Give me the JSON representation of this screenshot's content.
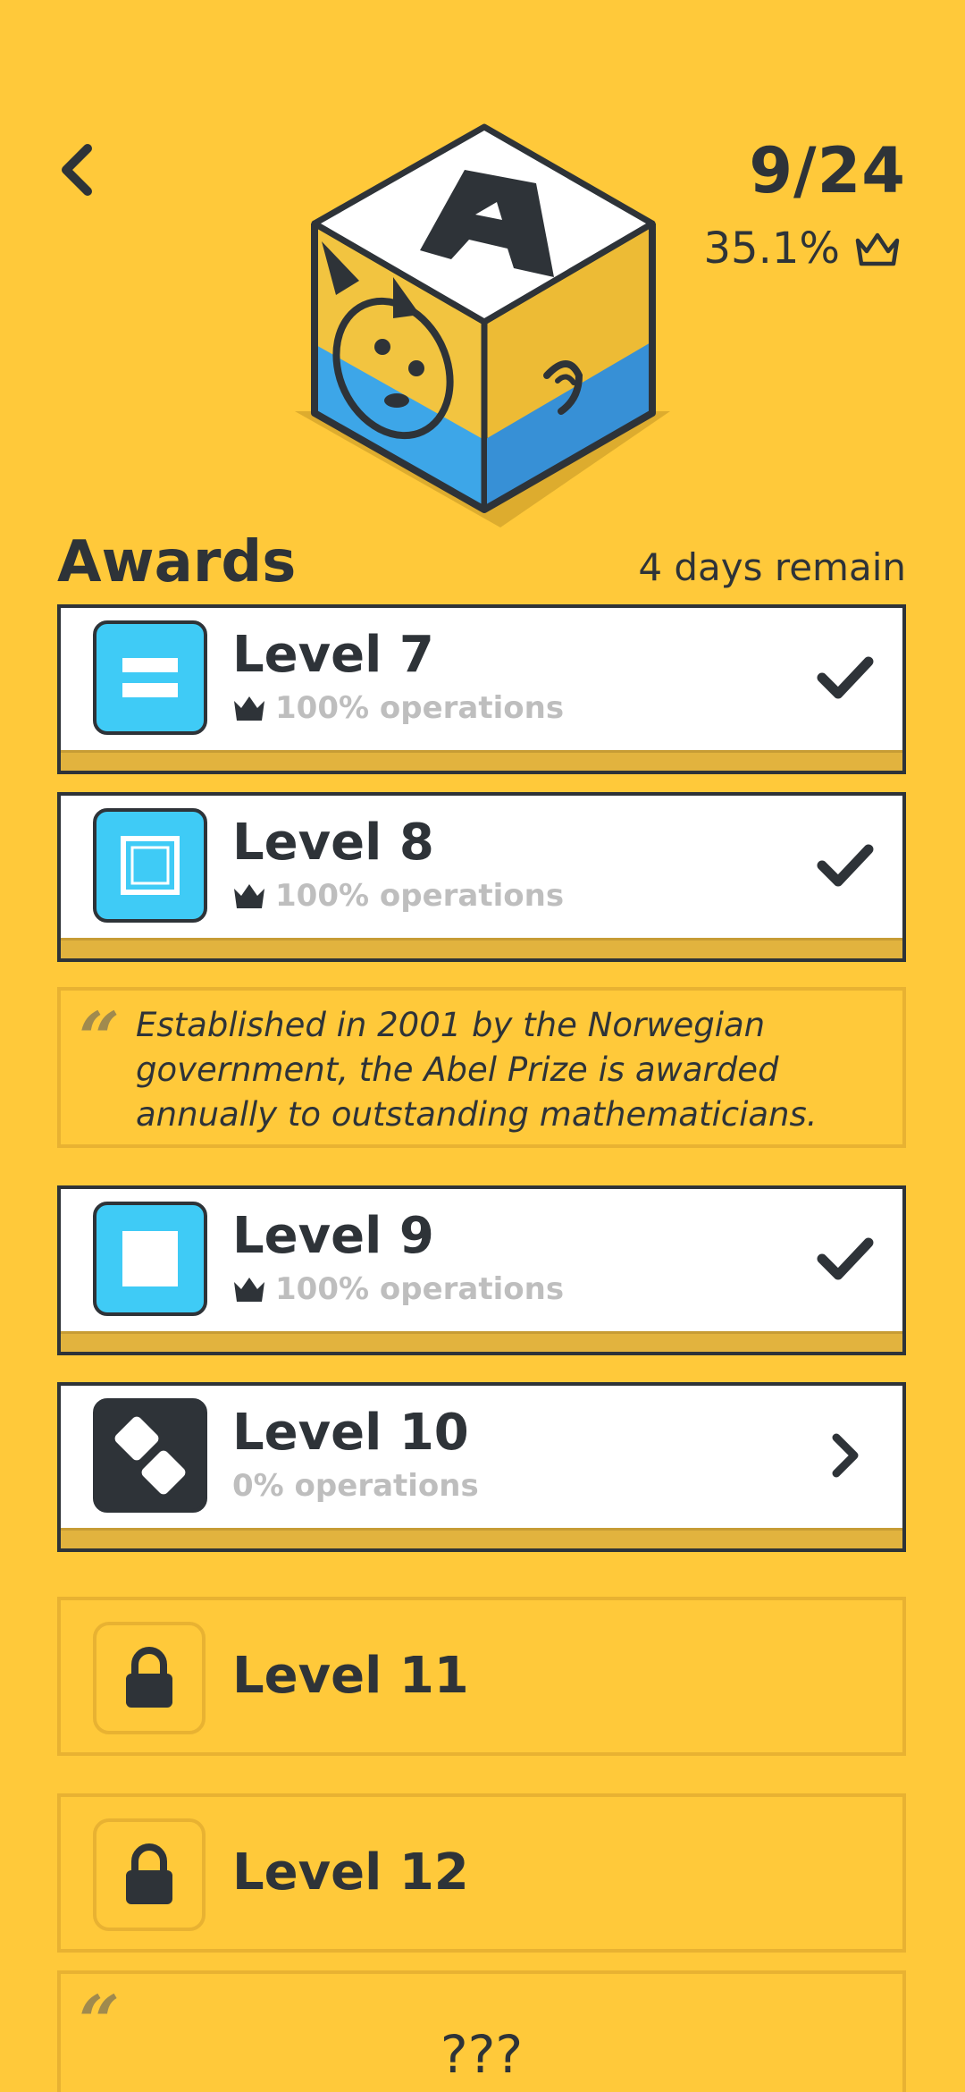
{
  "header": {
    "progress": "9/24",
    "percent": "35.1%",
    "crown_icon": "crown-outline-icon",
    "back_icon": "chevron-left-icon"
  },
  "awards": {
    "title": "Awards",
    "remaining": "4 days remain"
  },
  "levels": [
    {
      "title": "Level 7",
      "subtitle": "100% operations",
      "status": "completed",
      "icon": "equals-icon"
    },
    {
      "title": "Level 8",
      "subtitle": "100% operations",
      "status": "completed",
      "icon": "square-outline-icon"
    },
    {
      "title": "Level 9",
      "subtitle": "100% operations",
      "status": "completed",
      "icon": "square-filled-icon"
    },
    {
      "title": "Level 10",
      "subtitle": "0% operations",
      "status": "available",
      "icon": "dominoes-icon"
    },
    {
      "title": "Level 11",
      "status": "locked",
      "icon": "lock-icon"
    },
    {
      "title": "Level 12",
      "status": "locked",
      "icon": "lock-icon"
    }
  ],
  "quotes": [
    {
      "mark": "“",
      "text": "Established in 2001 by the Norwegian government, the Abel Prize is awarded annually to outstanding mathematicians."
    },
    {
      "mark": "“",
      "text": "???"
    }
  ],
  "colors": {
    "background": "#FFC93A",
    "accent_blue": "#3FCBF6",
    "text_dark": "#2E3338",
    "muted_text": "#BEBEBE",
    "locked_border": "#E8B232"
  }
}
